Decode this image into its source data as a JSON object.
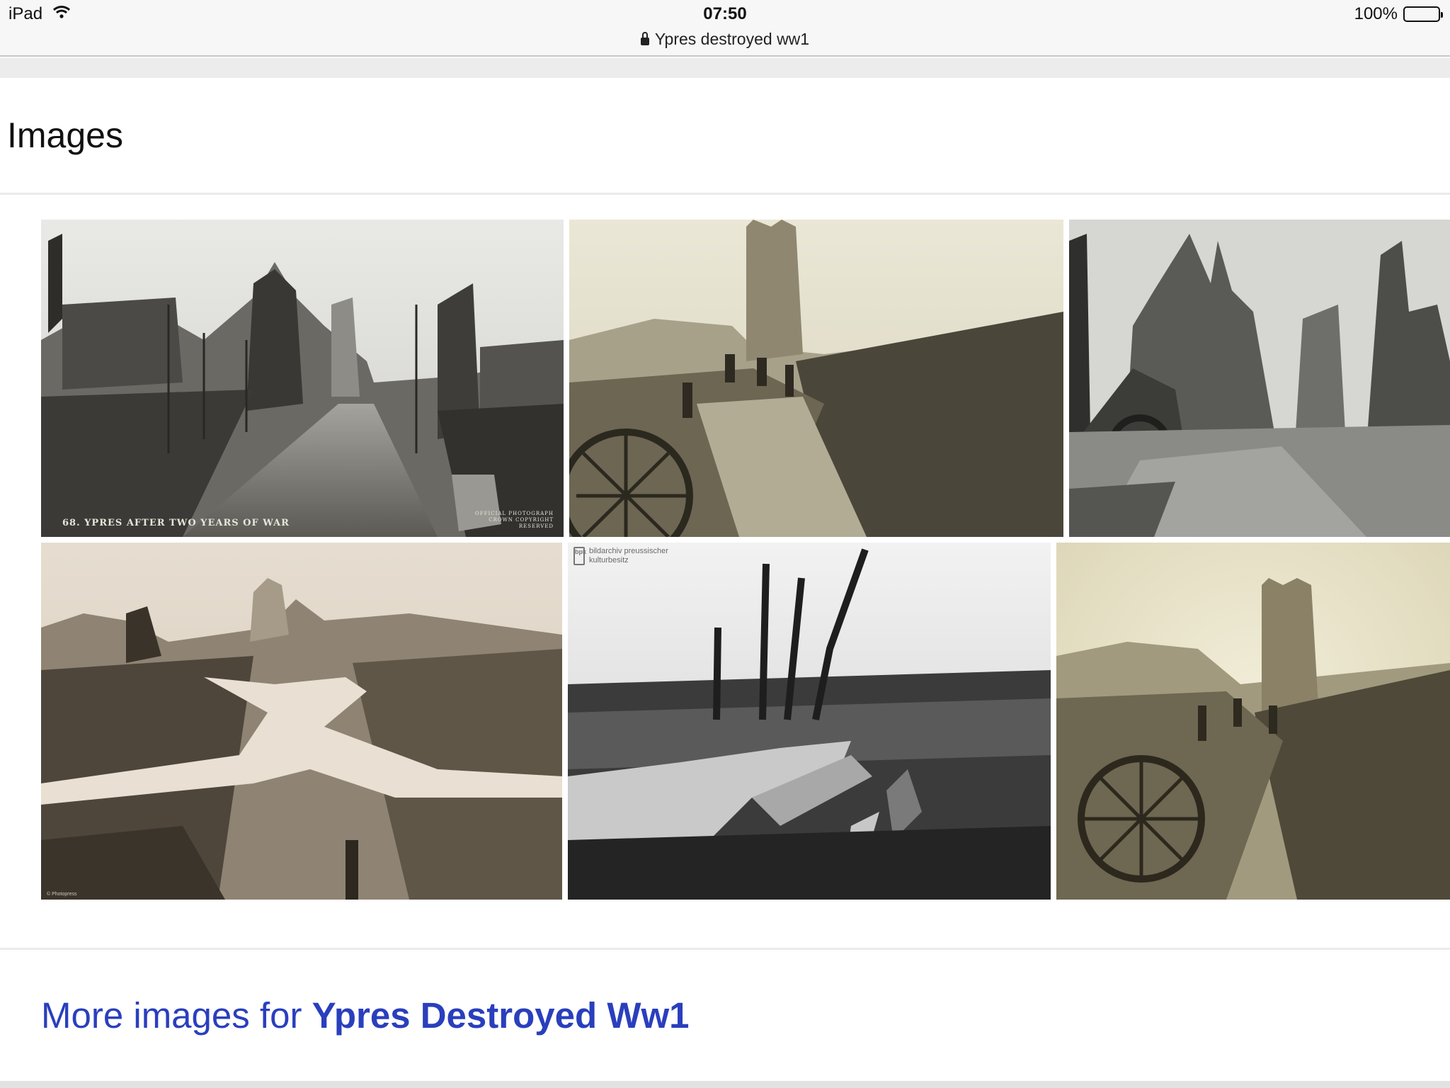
{
  "status_bar": {
    "device": "iPad",
    "time": "07:50",
    "battery": "100%"
  },
  "address_bar": {
    "title": "Ypres destroyed ww1"
  },
  "section": {
    "title": "Images"
  },
  "images": [
    {
      "caption": "68. YPRES AFTER TWO YEARS OF WAR",
      "side_caption": "OFFICIAL PHOTOGRAPH CROWN COPYRIGHT RESERVED"
    },
    {},
    {},
    {
      "copyright": "© Photopress"
    },
    {
      "watermark_logo": "bpk",
      "watermark_text_1": "bildarchiv preussischer",
      "watermark_text_2": "kulturbesitz"
    },
    {}
  ],
  "more_images": {
    "prefix": "More images for ",
    "query": "Ypres Destroyed Ww1"
  }
}
